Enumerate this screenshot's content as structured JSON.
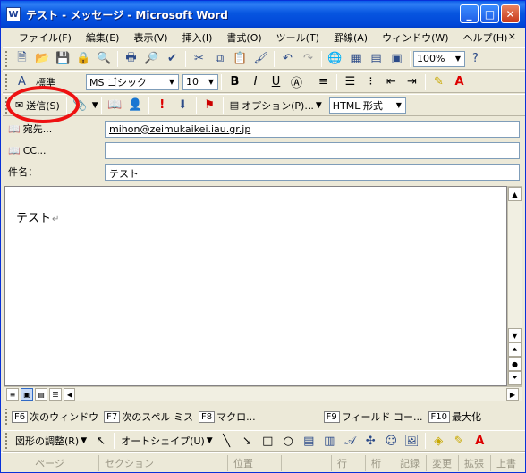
{
  "window": {
    "title": "テスト - メッセージ - Microsoft Word",
    "icon_label": "W"
  },
  "menu": {
    "items": [
      "ファイル(F)",
      "編集(E)",
      "表示(V)",
      "挿入(I)",
      "書式(O)",
      "ツール(T)",
      "罫線(A)",
      "ウィンドウ(W)",
      "ヘルプ(H)"
    ],
    "close_label": "×"
  },
  "toolbar2": {
    "style": "標準",
    "font": "MS ゴシック",
    "size": "10",
    "zoom": "100%"
  },
  "toolbar3": {
    "send": "送信(S)",
    "options": "オプション(P)...",
    "format": "HTML 形式"
  },
  "fields": {
    "to_label": "宛先...",
    "to_value": "mihon@zeimukaikei.iau.gr.jp",
    "cc_label": "CC...",
    "cc_value": "",
    "subject_label": "件名：",
    "subject_value": "テスト"
  },
  "document": {
    "text": "テスト",
    "para_mark": "↵"
  },
  "fkeys": [
    {
      "key": "F6",
      "label": "次のウィンドウ"
    },
    {
      "key": "F7",
      "label": "次のスペル ミス"
    },
    {
      "key": "F8",
      "label": "マクロ..."
    },
    {
      "key": "F9",
      "label": "フィールド コー..."
    },
    {
      "key": "F10",
      "label": "最大化"
    }
  ],
  "drawbar": {
    "adjust": "図形の調整(R)",
    "autoshape": "オートシェイプ(U)"
  },
  "status": [
    "ページ",
    "セクション",
    "",
    "位置",
    "",
    "行",
    "桁",
    "記録",
    "変更",
    "拡張",
    "上書"
  ],
  "colors": {
    "annotation": "#ee1111",
    "titlebar": "#0756e0"
  }
}
